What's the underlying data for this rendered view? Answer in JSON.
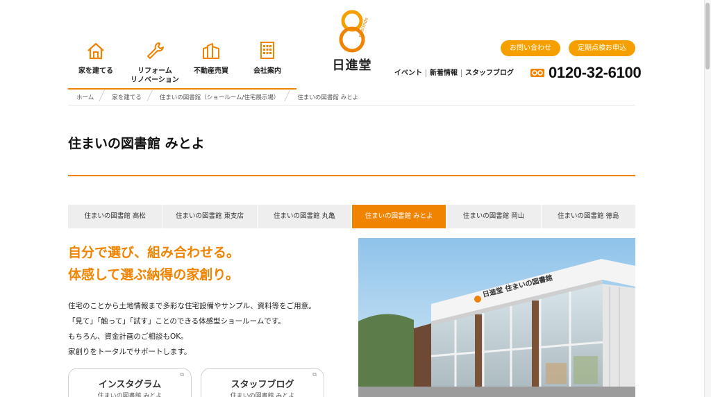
{
  "header": {
    "nav": [
      {
        "label": "家を建てる",
        "icon": "house-icon"
      },
      {
        "label": "リフォーム\nリノベーション",
        "icon": "wrench-icon"
      },
      {
        "label": "不動産売買",
        "icon": "building-columns-icon"
      },
      {
        "label": "会社案内",
        "icon": "office-building-icon"
      }
    ],
    "logo_text": "日進堂",
    "logo_arc_text": "nisshindo",
    "contact_label": "お問い合わせ",
    "inspection_label": "定期点検お申込",
    "sub_links": [
      "イベント",
      "新着情報",
      "スタッフブログ"
    ],
    "phone": "0120-32-6100"
  },
  "breadcrumb": [
    "ホーム",
    "家を建てる",
    "住まいの図書館（ショールーム/住宅展示場）",
    "住まいの図書館 みとよ"
  ],
  "page_title": "住まいの図書館 みとよ",
  "tabs": [
    {
      "label": "住まいの図書館 高松",
      "active": false
    },
    {
      "label": "住まいの図書館 東支店",
      "active": false
    },
    {
      "label": "住まいの図書館 丸亀",
      "active": false
    },
    {
      "label": "住まいの図書館 みとよ",
      "active": true
    },
    {
      "label": "住まいの図書館 岡山",
      "active": false
    },
    {
      "label": "住まいの図書館 徳島",
      "active": false
    }
  ],
  "headline": [
    "自分で選び、組み合わせる。",
    "体感して選ぶ納得の家創り。"
  ],
  "body": [
    "住宅のことから土地情報まで多彩な住宅設備やサンプル、資料等をご用意。",
    "「見て」「触って」「試す」ことのできる体感型ショールームです。",
    "もちろん、資金計画のご相談もOK。",
    "家創りをトータルでサポートします。"
  ],
  "cards": [
    {
      "title": "インスタグラム",
      "sub": "住まいの図書館 みとよ"
    },
    {
      "title": "スタッフブログ",
      "sub": "住まいの図書館 みとよ"
    }
  ],
  "photo_sign": "日進堂 住まいの図書館",
  "colors": {
    "accent": "#f08300",
    "pill": "#f5a000",
    "tab_bg": "#eeeeee"
  }
}
